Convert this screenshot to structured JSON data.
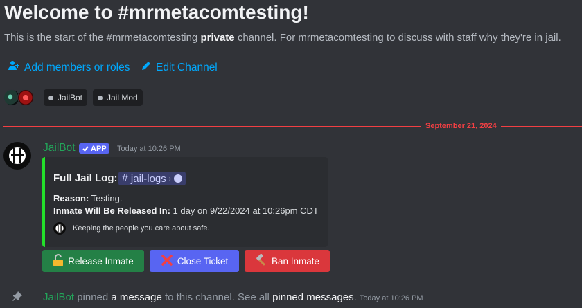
{
  "welcome": {
    "title": "Welcome to #mrmetacomtesting!",
    "intro_before": "This is the start of the #mrmetacomtesting ",
    "intro_bold": "private",
    "intro_after": " channel. For mrmetacomtesting to discuss with staff why they're in jail."
  },
  "actions": {
    "add_members": "Add members or roles",
    "edit_channel": "Edit Channel"
  },
  "members": {
    "pills": [
      "JailBot",
      "Jail Mod"
    ]
  },
  "divider": {
    "date": "September 21, 2024"
  },
  "message": {
    "username": "JailBot",
    "app_tag": "APP",
    "timestamp": "Today at 10:26 PM",
    "embed": {
      "title": "Full Jail Log:",
      "channel_mention": "jail-logs",
      "reason_label": "Reason:",
      "reason_value": " Testing.",
      "release_label": "Inmate Will Be Released In:",
      "release_value": " 1 day on 9/22/2024 at 10:26pm CDT",
      "footer": "Keeping the people you care about safe.",
      "accent_color": "#23e02a"
    },
    "buttons": {
      "release": "Release Inmate",
      "close": "Close Ticket",
      "ban": "Ban Inmate"
    }
  },
  "system": {
    "username": "JailBot",
    "text1": " pinned ",
    "link1": "a message",
    "text2": " to this channel. See all ",
    "link2": "pinned messages",
    "text3": ".",
    "timestamp": "Today at 10:26 PM"
  },
  "colors": {
    "background": "#313338",
    "link": "#00a8fc",
    "username": "#23a55a",
    "divider": "#f23f43",
    "btn_success": "#248046",
    "btn_primary": "#5865f2",
    "btn_danger": "#da373c"
  }
}
